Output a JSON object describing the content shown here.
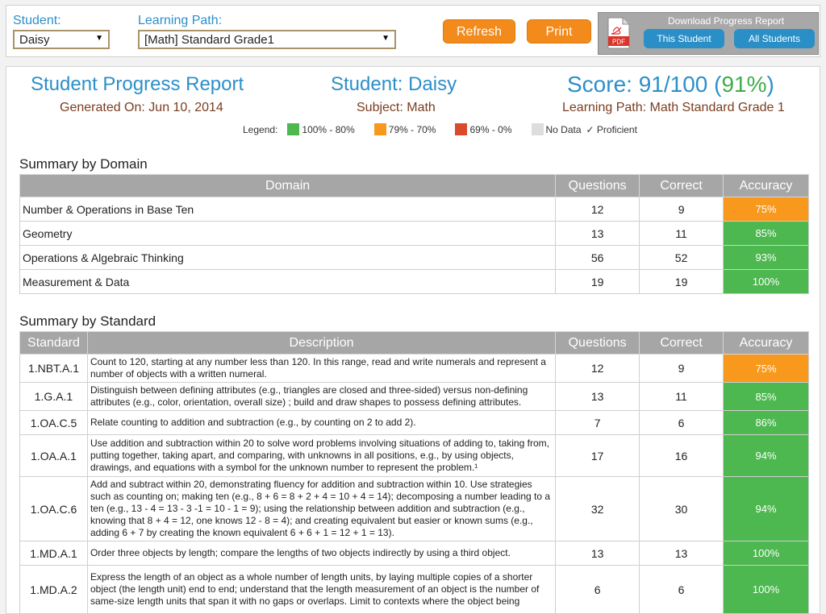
{
  "toolbar": {
    "student_label": "Student:",
    "student_value": "Daisy",
    "path_label": "Learning Path:",
    "path_value": "[Math] Standard Grade1",
    "refresh": "Refresh",
    "print": "Print",
    "download_title": "Download Progress Report",
    "pdf_label": "PDF",
    "this_student": "This Student",
    "all_students": "All Students"
  },
  "header": {
    "title": "Student Progress Report",
    "generated": "Generated On: Jun 10, 2014",
    "student": "Student: Daisy",
    "subject": "Subject: Math",
    "score_prefix": "Score: 91/100 (",
    "score_pct": "91%",
    "score_suffix": ")",
    "learning_path": "Learning Path: Math Standard Grade 1"
  },
  "legend": {
    "label": "Legend:",
    "items": [
      {
        "text": "100% - 80%",
        "color": "#4cb84f"
      },
      {
        "text": "79% - 70%",
        "color": "#f8991d"
      },
      {
        "text": "69% - 0%",
        "color": "#d94b2b"
      },
      {
        "text": "No Data",
        "color": "#dddddd"
      }
    ],
    "proficient": "✓ Proficient"
  },
  "colors": {
    "green": "#4cb84f",
    "orange": "#f8991d",
    "red": "#d94b2b",
    "blue": "#2c8fc9"
  },
  "domain": {
    "title": "Summary by Domain",
    "headers": [
      "Domain",
      "Questions",
      "Correct",
      "Accuracy"
    ],
    "rows": [
      {
        "name": "Number & Operations in Base Ten",
        "questions": "12",
        "correct": "9",
        "accuracy": "75%",
        "level": "orange"
      },
      {
        "name": "Geometry",
        "questions": "13",
        "correct": "11",
        "accuracy": "85%",
        "level": "green"
      },
      {
        "name": "Operations & Algebraic Thinking",
        "questions": "56",
        "correct": "52",
        "accuracy": "93%",
        "level": "green"
      },
      {
        "name": "Measurement & Data",
        "questions": "19",
        "correct": "19",
        "accuracy": "100%",
        "level": "green"
      }
    ]
  },
  "standard": {
    "title": "Summary by Standard",
    "headers": [
      "Standard",
      "Description",
      "Questions",
      "Correct",
      "Accuracy"
    ],
    "rows": [
      {
        "code": "1.NBT.A.1",
        "desc": "Count to 120, starting at any number less than 120. In this range, read and write numerals and represent a number of objects with a written numeral.",
        "questions": "12",
        "correct": "9",
        "accuracy": "75%",
        "level": "orange"
      },
      {
        "code": "1.G.A.1",
        "desc": "Distinguish between defining attributes (e.g., triangles are closed and three-sided) versus non-defining attributes (e.g., color, orientation, overall size) ; build and draw shapes to possess defining attributes.",
        "questions": "13",
        "correct": "11",
        "accuracy": "85%",
        "level": "green"
      },
      {
        "code": "1.OA.C.5",
        "desc": "Relate counting to addition and subtraction (e.g., by counting on 2 to add 2).",
        "questions": "7",
        "correct": "6",
        "accuracy": "86%",
        "level": "green"
      },
      {
        "code": "1.OA.A.1",
        "desc": "Use addition and subtraction within 20 to solve word problems involving situations of adding to, taking from, putting together, taking apart, and comparing, with unknowns in all positions, e.g., by using objects, drawings, and equations with a symbol for the unknown number to represent the problem.¹",
        "questions": "17",
        "correct": "16",
        "accuracy": "94%",
        "level": "green"
      },
      {
        "code": "1.OA.C.6",
        "desc": "Add and subtract within 20, demonstrating fluency for addition and subtraction within 10. Use strategies such as counting on; making ten (e.g., 8 + 6 = 8 + 2 + 4 = 10 + 4 = 14); decomposing a number leading to a ten (e.g., 13 - 4 = 13 - 3 -1 = 10 - 1 = 9); using the relationship between addition and subtraction (e.g., knowing that 8 + 4 = 12, one knows 12 - 8 = 4); and creating equivalent but easier or known sums (e.g., adding 6 + 7 by creating the known equivalent 6 + 6 + 1 = 12 + 1 = 13).",
        "questions": "32",
        "correct": "30",
        "accuracy": "94%",
        "level": "green"
      },
      {
        "code": "1.MD.A.1",
        "desc": "Order three objects by length; compare the lengths of two objects indirectly by using a third object.",
        "questions": "13",
        "correct": "13",
        "accuracy": "100%",
        "level": "green"
      },
      {
        "code": "1.MD.A.2",
        "desc": "Express the length of an object as a whole number of length units, by laying multiple copies of a shorter object (the length unit) end to end; understand that the length measurement of an object is the number of same-size length units that span it with no gaps or overlaps. Limit to contexts where the object being",
        "questions": "6",
        "correct": "6",
        "accuracy": "100%",
        "level": "green"
      }
    ]
  }
}
